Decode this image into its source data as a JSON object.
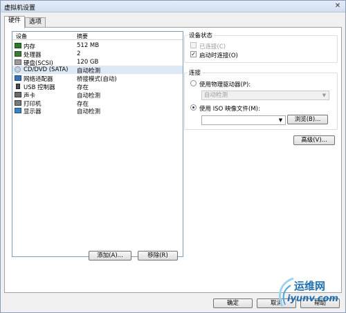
{
  "window": {
    "title": "虚拟机设置",
    "close_glyph": "✕"
  },
  "tabs": [
    {
      "label": "硬件",
      "active": true
    },
    {
      "label": "选项",
      "active": false
    }
  ],
  "device_list": {
    "headers": {
      "device": "设备",
      "summary": "摘要"
    },
    "rows": [
      {
        "icon": "memory-icon",
        "device": "内存",
        "summary": "512 MB",
        "selected": false
      },
      {
        "icon": "processor-icon",
        "device": "处理器",
        "summary": "2",
        "selected": false
      },
      {
        "icon": "hard-disk-icon",
        "device": "硬盘(SCSI)",
        "summary": "120 GB",
        "selected": false
      },
      {
        "icon": "cd-dvd-icon",
        "device": "CD/DVD (SATA)",
        "summary": "自动检测",
        "selected": true
      },
      {
        "icon": "network-adapter-icon",
        "device": "网络适配器",
        "summary": "桥接模式(自动)",
        "selected": false
      },
      {
        "icon": "usb-icon",
        "device": "USB 控制器",
        "summary": "存在",
        "selected": false
      },
      {
        "icon": "sound-card-icon",
        "device": "声卡",
        "summary": "自动检测",
        "selected": false
      },
      {
        "icon": "printer-icon",
        "device": "打印机",
        "summary": "存在",
        "selected": false
      },
      {
        "icon": "display-icon",
        "device": "显示器",
        "summary": "自动检测",
        "selected": false
      }
    ]
  },
  "list_buttons": {
    "add": "添加(A)...",
    "remove": "移除(R)"
  },
  "device_status": {
    "title": "设备状态",
    "connected_label": "已连接(C)",
    "connected_checked": false,
    "connect_on_power_label": "启动时连接(O)",
    "connect_on_power_checked": true,
    "check_glyph": "✓"
  },
  "connection": {
    "title": "连接",
    "physical_label": "使用物理驱动器(P):",
    "physical_selected": false,
    "physical_value": "自动检测",
    "iso_label": "使用 ISO 映像文件(M):",
    "iso_selected": true,
    "iso_value": "",
    "browse_button": "浏览(B)..."
  },
  "advanced_button": "高级(V)...",
  "footer_buttons": {
    "ok": "确定",
    "cancel": "取消",
    "help": "帮助"
  },
  "watermark": {
    "text": "运维网",
    "url": "iyunv.com"
  },
  "colors": {
    "selected_row": "#dde8f5",
    "titlebar": "#d3dff0",
    "watermark": "#1f6fb0"
  }
}
